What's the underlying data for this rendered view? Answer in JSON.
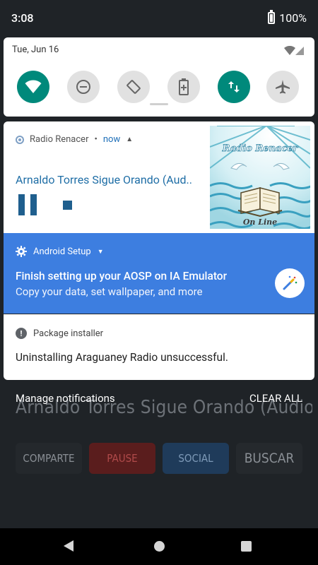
{
  "status_bar": {
    "time": "3:08",
    "battery": "100%"
  },
  "quick_settings": {
    "date": "Tue, Jun 16",
    "tiles": [
      {
        "name": "wifi",
        "state": "on"
      },
      {
        "name": "do-not-disturb",
        "state": "off"
      },
      {
        "name": "auto-rotate",
        "state": "off"
      },
      {
        "name": "battery-saver",
        "state": "off"
      },
      {
        "name": "mobile-data",
        "state": "on"
      },
      {
        "name": "airplane-mode",
        "state": "off"
      }
    ],
    "accent_color": "#00897b"
  },
  "media_notification": {
    "app": "Radio Renacer",
    "time": "now",
    "track": "Arnaldo Torres   Sigue Orando (Aud..",
    "art_title": "Radio Renacer",
    "art_subtitle": "On Line"
  },
  "setup_notification": {
    "app": "Android Setup",
    "title": "Finish setting up your AOSP on IA Emulator",
    "text": "Copy your data, set wallpaper, and more",
    "color": "#3d7ee0"
  },
  "installer_notification": {
    "app": "Package installer",
    "text": "Uninstalling Araguaney Radio unsuccessful."
  },
  "footer": {
    "manage": "Manage notifications",
    "clear": "CLEAR ALL"
  },
  "background_app": {
    "track": "Arnaldo Torres   Sigue Orando (Audio Pr..",
    "buttons": [
      "COMPARTE",
      "PAUSE",
      "SOCIAL",
      "BUSCAR"
    ]
  }
}
